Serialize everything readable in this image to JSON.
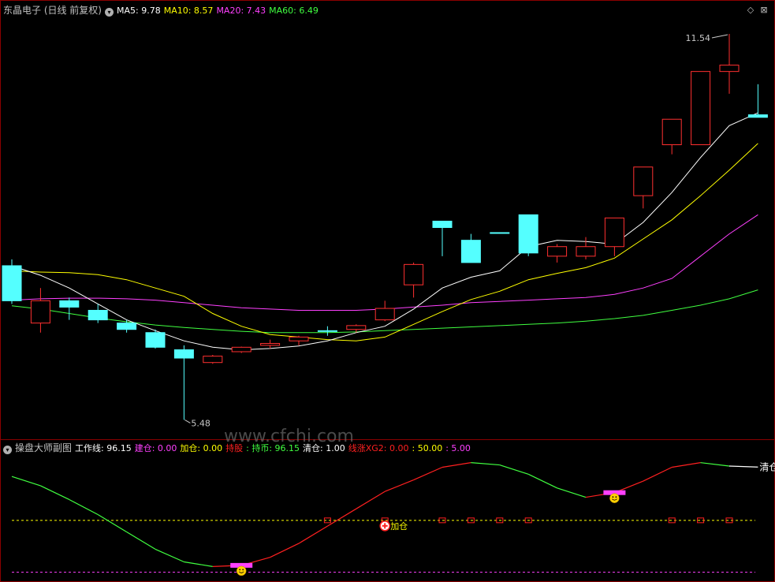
{
  "main_panel": {
    "title": "东晶电子 (日线 前复权)",
    "ma": [
      {
        "label": "MA5:",
        "value": "9.78",
        "color": "#ffffff"
      },
      {
        "label": "MA10:",
        "value": "8.57",
        "color": "#ffff00"
      },
      {
        "label": "MA20:",
        "value": "7.43",
        "color": "#ff40ff"
      },
      {
        "label": "MA60:",
        "value": "6.49",
        "color": "#40ff40"
      }
    ],
    "high_label": "11.54",
    "low_label": "5.48",
    "price_range": [
      5.2,
      11.8
    ]
  },
  "sub_panel": {
    "title": "操盘大师副图",
    "items": [
      {
        "label": "工作线:",
        "value": "96.15",
        "color": "#ffffff"
      },
      {
        "label": "建仓:",
        "value": "0.00",
        "color": "#ff40ff"
      },
      {
        "label": "加仓:",
        "value": "0.00",
        "color": "#ffff00"
      },
      {
        "label": "持股",
        "value": "",
        "color": "#ff2020"
      },
      {
        "label": ": 持币:",
        "value": "96.15",
        "color": "#40ff40"
      },
      {
        "label": "清仓:",
        "value": "1.00",
        "color": "#ffffff"
      },
      {
        "label": "线涨XG2:",
        "value": "0.00",
        "color": "#ff2020"
      },
      {
        "label": ":",
        "value": "50.00",
        "color": "#ffff00"
      },
      {
        "label": ":",
        "value": "5.00",
        "color": "#ff40ff"
      }
    ],
    "jiacang_text": "加仓",
    "qingcang_text": "清仓",
    "levels": {
      "yellow": 50,
      "magenta": 5
    }
  },
  "watermark": "www.cfchi.com",
  "colors": {
    "up": "#ff3030",
    "down": "#54ffff",
    "ma5": "#ffffff",
    "ma10": "#ffff00",
    "ma20": "#ff40ff",
    "ma60": "#40ff40",
    "border": "#8b0000"
  },
  "chart_data": {
    "type": "candlestick",
    "candles": [
      {
        "o": 7.9,
        "c": 7.35,
        "h": 8.0,
        "l": 7.3
      },
      {
        "o": 7.0,
        "c": 7.35,
        "h": 7.55,
        "l": 6.85
      },
      {
        "o": 7.35,
        "c": 7.25,
        "h": 7.4,
        "l": 7.05
      },
      {
        "o": 7.2,
        "c": 7.05,
        "h": 7.3,
        "l": 7.0
      },
      {
        "o": 7.0,
        "c": 6.9,
        "h": 7.05,
        "l": 6.85
      },
      {
        "o": 6.85,
        "c": 6.62,
        "h": 6.9,
        "l": 6.6
      },
      {
        "o": 6.58,
        "c": 6.45,
        "h": 6.65,
        "l": 5.48
      },
      {
        "o": 6.38,
        "c": 6.48,
        "h": 6.5,
        "l": 6.36
      },
      {
        "o": 6.55,
        "c": 6.62,
        "h": 6.63,
        "l": 6.53
      },
      {
        "o": 6.65,
        "c": 6.68,
        "h": 6.74,
        "l": 6.6
      },
      {
        "o": 6.72,
        "c": 6.78,
        "h": 6.8,
        "l": 6.65
      },
      {
        "o": 6.88,
        "c": 6.88,
        "h": 6.95,
        "l": 6.8
      },
      {
        "o": 6.9,
        "c": 6.96,
        "h": 6.98,
        "l": 6.85
      },
      {
        "o": 7.05,
        "c": 7.23,
        "h": 7.35,
        "l": 7.03
      },
      {
        "o": 7.6,
        "c": 7.92,
        "h": 7.95,
        "l": 7.4
      },
      {
        "o": 8.6,
        "c": 8.5,
        "h": 8.6,
        "l": 8.05
      },
      {
        "o": 8.3,
        "c": 7.95,
        "h": 8.4,
        "l": 7.95
      },
      {
        "o": 8.42,
        "c": 8.42,
        "h": 8.42,
        "l": 8.42
      },
      {
        "o": 8.7,
        "c": 8.1,
        "h": 8.7,
        "l": 8.05
      },
      {
        "o": 8.05,
        "c": 8.2,
        "h": 8.24,
        "l": 7.95
      },
      {
        "o": 8.05,
        "c": 8.2,
        "h": 8.35,
        "l": 8.0
      },
      {
        "o": 8.2,
        "c": 8.65,
        "h": 8.65,
        "l": 8.05
      },
      {
        "o": 9.0,
        "c": 9.45,
        "h": 9.45,
        "l": 8.8
      },
      {
        "o": 9.8,
        "c": 10.2,
        "h": 10.2,
        "l": 9.65
      },
      {
        "o": 9.8,
        "c": 10.95,
        "h": 10.95,
        "l": 9.8
      },
      {
        "o": 10.95,
        "c": 11.05,
        "h": 11.54,
        "l": 10.6
      },
      {
        "o": 10.27,
        "c": 10.23,
        "h": 10.75,
        "l": 10.23
      }
    ],
    "ma5": [
      7.9,
      7.75,
      7.55,
      7.3,
      7.05,
      6.88,
      6.72,
      6.62,
      6.58,
      6.6,
      6.64,
      6.72,
      6.85,
      6.95,
      7.22,
      7.55,
      7.72,
      7.82,
      8.2,
      8.3,
      8.28,
      8.24,
      8.58,
      9.05,
      9.6,
      10.1,
      10.3
    ],
    "ma10": [
      7.82,
      7.8,
      7.79,
      7.76,
      7.68,
      7.55,
      7.42,
      7.15,
      6.95,
      6.82,
      6.78,
      6.74,
      6.72,
      6.78,
      6.98,
      7.18,
      7.37,
      7.5,
      7.68,
      7.78,
      7.87,
      8.02,
      8.32,
      8.62,
      9.0,
      9.4,
      9.82
    ],
    "ma20": [
      7.36,
      7.38,
      7.39,
      7.39,
      7.38,
      7.36,
      7.32,
      7.28,
      7.24,
      7.22,
      7.2,
      7.2,
      7.2,
      7.22,
      7.25,
      7.28,
      7.32,
      7.34,
      7.36,
      7.38,
      7.4,
      7.45,
      7.55,
      7.7,
      8.05,
      8.4,
      8.7
    ],
    "ma60": [
      7.27,
      7.22,
      7.15,
      7.08,
      7.02,
      6.97,
      6.93,
      6.9,
      6.87,
      6.85,
      6.85,
      6.85,
      6.86,
      6.88,
      6.9,
      6.92,
      6.94,
      6.96,
      6.98,
      7.0,
      7.03,
      7.07,
      7.12,
      7.2,
      7.28,
      7.38,
      7.52
    ],
    "work_line": [
      88,
      80,
      68,
      55,
      40,
      25,
      14,
      10,
      11,
      18,
      30,
      45,
      60,
      75,
      85,
      96,
      100,
      98,
      90,
      78,
      70,
      74,
      84,
      96,
      100,
      97,
      96.15
    ],
    "work_line_range": [
      0,
      110
    ],
    "red_box_indices": [
      11,
      13,
      15,
      16,
      17,
      18,
      23,
      24,
      25
    ],
    "jiacang_index": 13,
    "smile_indices": [
      8,
      21
    ]
  }
}
